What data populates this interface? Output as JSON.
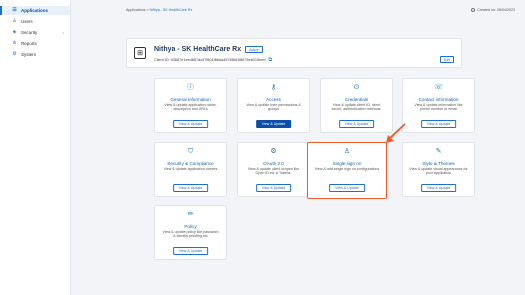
{
  "sidebar": {
    "items": [
      {
        "label": "Applications",
        "icon": "list-icon",
        "active": true
      },
      {
        "label": "Users",
        "icon": "user-icon"
      },
      {
        "label": "Security",
        "icon": "shield-icon",
        "has_caret": true
      },
      {
        "label": "Reports",
        "icon": "chart-icon"
      },
      {
        "label": "System",
        "icon": "gear-icon"
      }
    ]
  },
  "topbar": {
    "breadcrumb_root": "Applications",
    "breadcrumb_sep": ">",
    "breadcrumb_current": "Nithya - SK HealthCare Rx",
    "created": "Created on: 28/04/2023"
  },
  "app": {
    "title": "Nithya - SK HealthCare Rx",
    "status": "Active",
    "client_id": "Client ID: 54687e1eed857dc57f801f8b6a4576f8d1f8678eb015eed",
    "edit_label": "Edit"
  },
  "cards": [
    {
      "title": "General information",
      "desc": "View & update application name, description and URLs",
      "btn": "View & Update",
      "icon": "info-icon"
    },
    {
      "title": "Access",
      "desc": "View & update user permissions & groups",
      "btn": "View & Update",
      "icon": "key-icon",
      "primary": true
    },
    {
      "title": "Credentials",
      "desc": "View & update client ID, client secret, authentication methods.",
      "btn": "View & Update",
      "icon": "lock-icon"
    },
    {
      "title": "Contact information",
      "desc": "View & update information like phone number or email",
      "btn": "View & Update",
      "icon": "contact-icon"
    },
    {
      "title": "Security & Compliance",
      "desc": "View & update application owners",
      "btn": "View & Update",
      "icon": "shield-check-icon"
    },
    {
      "title": "OAuth 2.0",
      "desc": "View & update client scopes like Open ID etc & Tokens.",
      "btn": "View & Update",
      "icon": "oauth-gear-icon"
    },
    {
      "title": "Single sign on",
      "desc": "View & add single sign on configurations",
      "btn": "View & Update",
      "icon": "sso-users-icon",
      "highlight": true
    },
    {
      "title": "Style & Themes",
      "desc": "View & update visual appearance for your application",
      "btn": "View & Update",
      "icon": "brush-icon"
    },
    {
      "title": "Policy",
      "desc": "View & update policy like password & identity proofing etc",
      "btn": "View & Update",
      "icon": "pencil-icon"
    }
  ],
  "colors": {
    "accent": "#1f6fd0",
    "primary": "#0b4fa6",
    "highlight": "#f05a28"
  }
}
